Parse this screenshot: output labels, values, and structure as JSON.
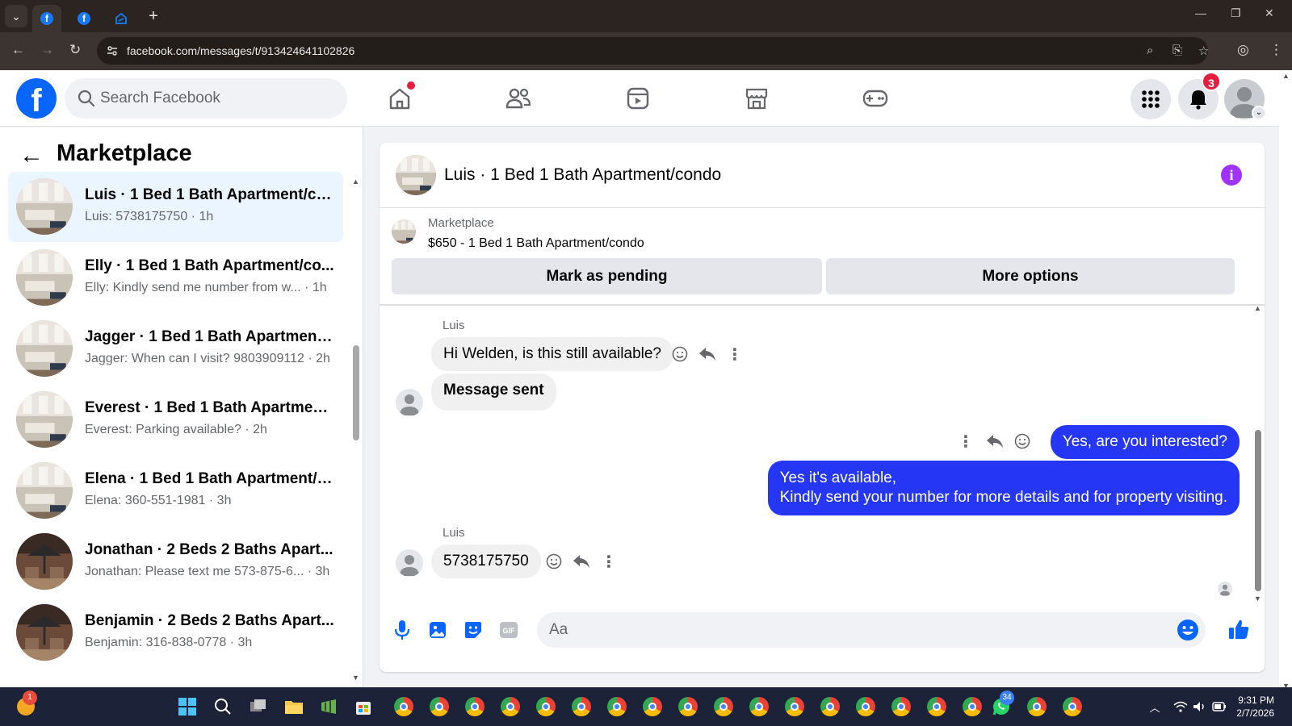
{
  "browser": {
    "url": "facebook.com/messages/t/913424641102826"
  },
  "fb": {
    "logo_letter": "f",
    "search_placeholder": "Search Facebook",
    "notif_count": "3"
  },
  "sidebar": {
    "title": "Marketplace",
    "conversations": [
      {
        "title": "Luis · 1 Bed 1 Bath Apartment/co...",
        "subtitle": "Luis: 5738175750 · 1h"
      },
      {
        "title": "Elly · 1 Bed 1 Bath Apartment/co...",
        "subtitle": "Elly: Kindly send me number from w... · 1h"
      },
      {
        "title": "Jagger · 1 Bed 1 Bath Apartment/...",
        "subtitle": "Jagger: When can I visit? 9803909112 · 2h"
      },
      {
        "title": "Everest · 1 Bed 1 Bath Apartment...",
        "subtitle": "Everest: Parking available? · 2h"
      },
      {
        "title": "Elena · 1 Bed 1 Bath Apartment/c...",
        "subtitle": "Elena: 360-551-1981 · 3h"
      },
      {
        "title": "Jonathan · 2 Beds 2 Baths Apart...",
        "subtitle": "Jonathan: Please text me 573-875-6... · 3h"
      },
      {
        "title": "Benjamin · 2 Beds 2 Baths Apart...",
        "subtitle": "Benjamin: 316-838-0778 · 3h"
      }
    ]
  },
  "chat": {
    "title": "Luis · 1 Bed 1 Bath Apartment/condo",
    "marketplace_label": "Marketplace",
    "listing": "$650 - 1 Bed 1 Bath Apartment/condo",
    "mark_pending": "Mark as pending",
    "more_options": "More options",
    "sender1": "Luis",
    "msg1": "Hi Welden, is this still available?",
    "msg2": "Message sent",
    "msg3": "Yes, are you interested?",
    "msg4_line1": "Yes it's available,",
    "msg4_line2": "Kindly send your number for more details and for property visiting.",
    "sender2": "Luis",
    "msg5": "5738175750",
    "composer_placeholder": "Aa"
  },
  "taskbar": {
    "time": "9:31 PM",
    "date": "2/7/2026",
    "whatsapp_badge": "34",
    "weather_badge": "1"
  },
  "colors": {
    "fb_blue": "#0866ff",
    "outgoing_bubble": "#2636f5",
    "active_conv": "#ebf5ff",
    "notification_red": "#e41e3f"
  }
}
